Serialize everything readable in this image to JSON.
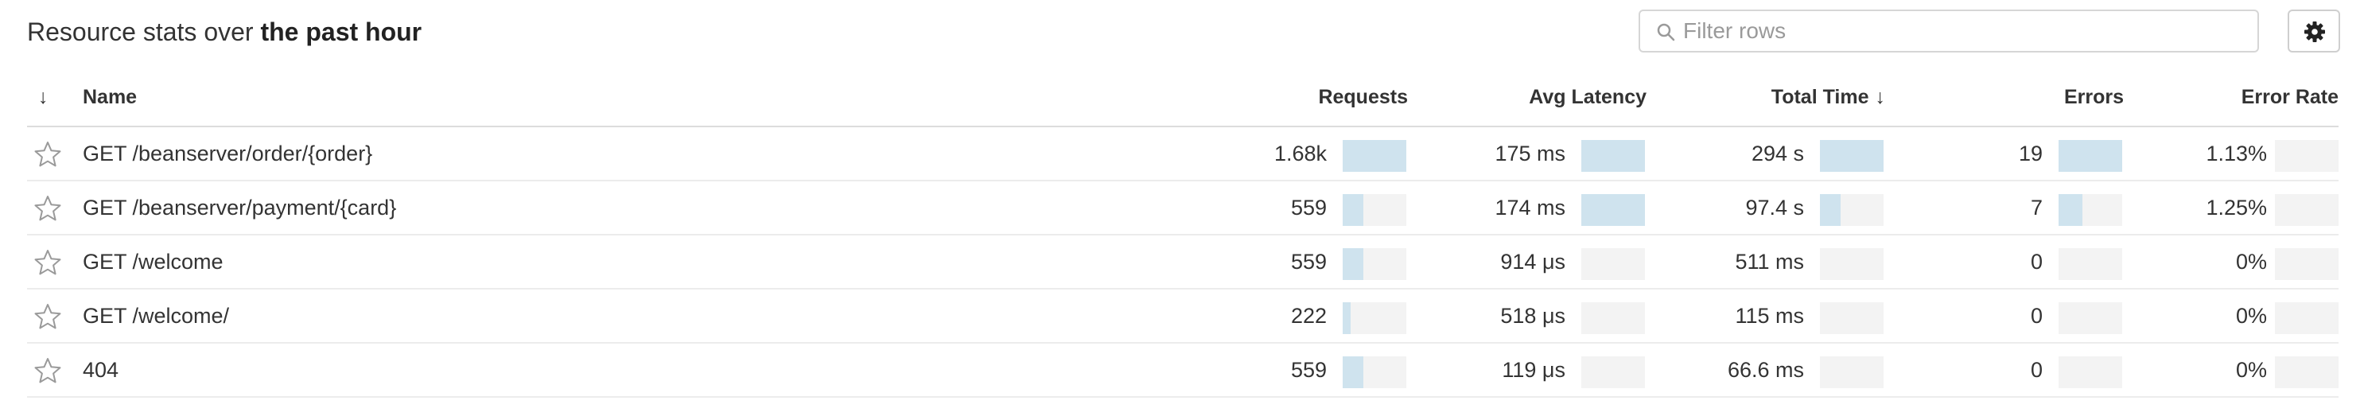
{
  "header": {
    "title_prefix": "Resource stats over ",
    "title_emphasis": "the past hour",
    "filter_placeholder": "Filter rows",
    "filter_value": ""
  },
  "icons": {
    "search": "search-icon",
    "settings": "gear-icon",
    "favorite": "star-outline-icon",
    "sort": "arrow-down-icon"
  },
  "colors": {
    "bar_fill": "#cfe3ee",
    "bar_track": "#f3f3f3",
    "star_outline": "#9a9a9a"
  },
  "table": {
    "columns": {
      "sort_indicator": "↓",
      "name": "Name",
      "requests": "Requests",
      "avg_latency": "Avg Latency",
      "total_time": "Total Time",
      "total_time_sort": "↓",
      "errors": "Errors",
      "error_rate": "Error Rate"
    },
    "rows": [
      {
        "name": "GET /beanserver/order/{order}",
        "requests": "1.68k",
        "requests_fraction": 1.0,
        "avg_latency": "175 ms",
        "avg_latency_fraction": 1.0,
        "total_time": "294 s",
        "total_time_fraction": 1.0,
        "errors": "19",
        "errors_fraction": 1.0,
        "error_rate": "1.13%",
        "error_rate_fraction": 0.0
      },
      {
        "name": "GET /beanserver/payment/{card}",
        "requests": "559",
        "requests_fraction": 0.33,
        "avg_latency": "174 ms",
        "avg_latency_fraction": 1.0,
        "total_time": "97.4 s",
        "total_time_fraction": 0.33,
        "errors": "7",
        "errors_fraction": 0.37,
        "error_rate": "1.25%",
        "error_rate_fraction": 0.0
      },
      {
        "name": "GET /welcome",
        "requests": "559",
        "requests_fraction": 0.33,
        "avg_latency": "914 μs",
        "avg_latency_fraction": 0.0,
        "total_time": "511 ms",
        "total_time_fraction": 0.0,
        "errors": "0",
        "errors_fraction": 0.0,
        "error_rate": "0%",
        "error_rate_fraction": 0.0
      },
      {
        "name": "GET /welcome/",
        "requests": "222",
        "requests_fraction": 0.13,
        "avg_latency": "518 μs",
        "avg_latency_fraction": 0.0,
        "total_time": "115 ms",
        "total_time_fraction": 0.0,
        "errors": "0",
        "errors_fraction": 0.0,
        "error_rate": "0%",
        "error_rate_fraction": 0.0
      },
      {
        "name": "404",
        "requests": "559",
        "requests_fraction": 0.33,
        "avg_latency": "119 μs",
        "avg_latency_fraction": 0.0,
        "total_time": "66.6 ms",
        "total_time_fraction": 0.0,
        "errors": "0",
        "errors_fraction": 0.0,
        "error_rate": "0%",
        "error_rate_fraction": 0.0
      }
    ]
  }
}
